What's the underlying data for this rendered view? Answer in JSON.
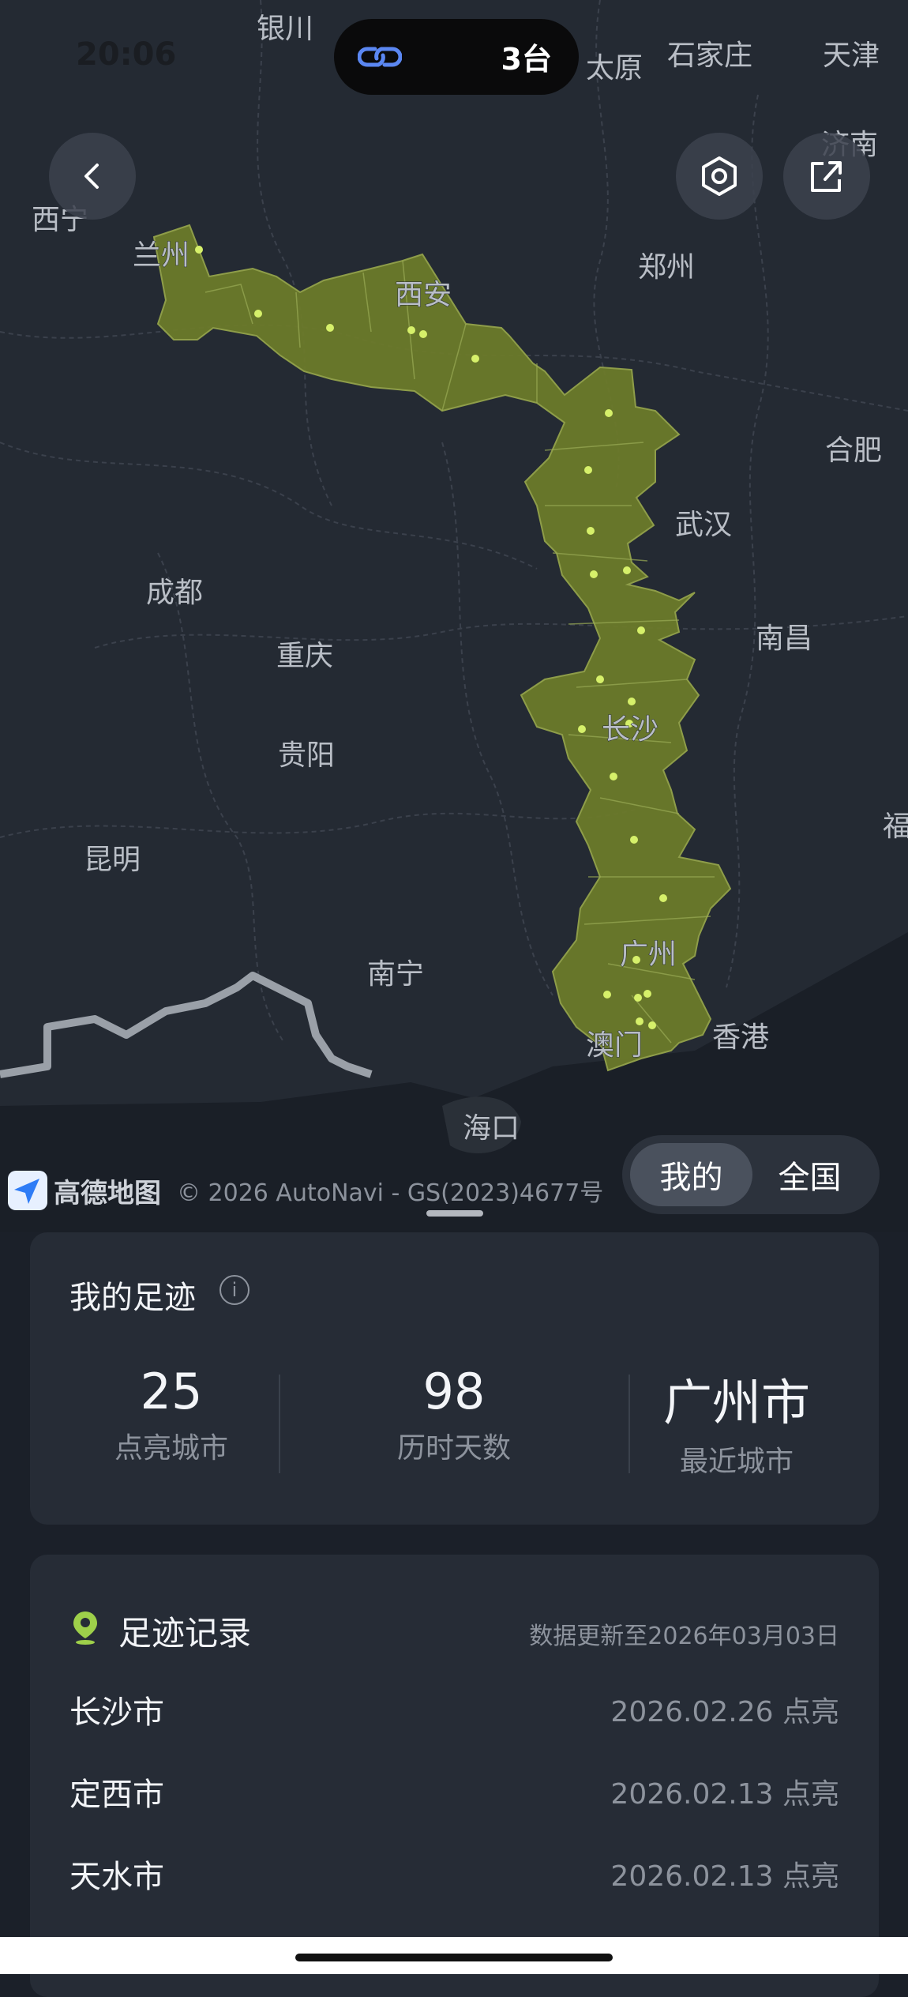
{
  "status_bar": {
    "time": "20:06",
    "device_count": "3台"
  },
  "map": {
    "labels": [
      "银川",
      "太原",
      "石家庄",
      "天津",
      "西宁",
      "兰州",
      "西安",
      "郑州",
      "济南",
      "合肥",
      "武汉",
      "成都",
      "重庆",
      "南昌",
      "长沙",
      "贵阳",
      "福",
      "昆明",
      "广州",
      "南宁",
      "澳门",
      "香港",
      "海口"
    ],
    "attribution_brand": "高德地图",
    "attribution_copy": "© 2026 AutoNavi - GS(2023)4677号",
    "view_toggle": {
      "mine": "我的",
      "all": "全国"
    },
    "colors": {
      "region_fill": "#6b7a2a",
      "dot": "#d6f06a"
    }
  },
  "footprint": {
    "title": "我的足迹",
    "stats": [
      {
        "value": "25",
        "label": "点亮城市"
      },
      {
        "value": "98",
        "label": "历时天数"
      },
      {
        "value": "广州市",
        "label": "最近城市"
      }
    ]
  },
  "records": {
    "title": "足迹记录",
    "updated": "数据更新至2026年03月03日",
    "items": [
      {
        "city": "长沙市",
        "date": "2026.02.26 点亮"
      },
      {
        "city": "定西市",
        "date": "2026.02.13 点亮"
      },
      {
        "city": "天水市",
        "date": "2026.02.13 点亮"
      }
    ]
  }
}
